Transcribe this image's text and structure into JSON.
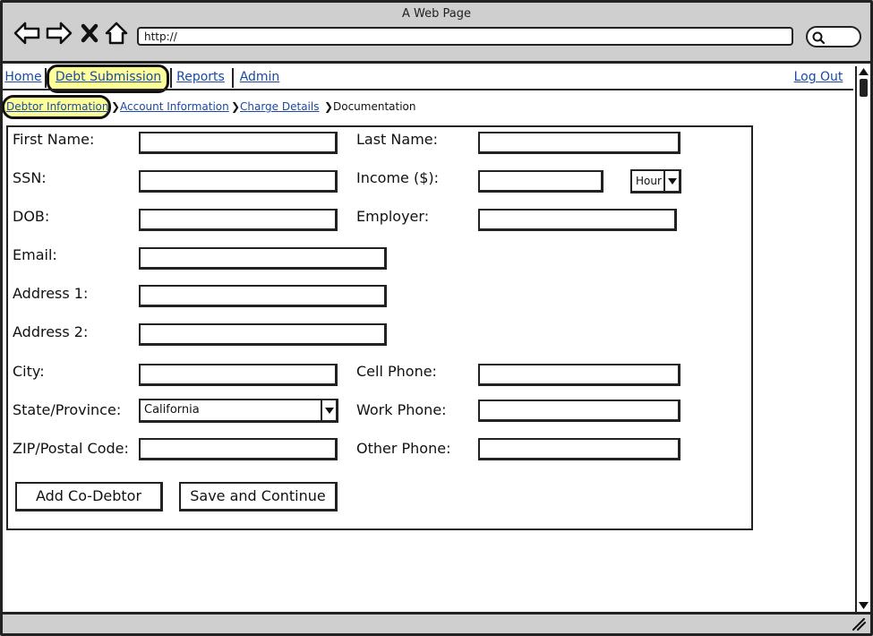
{
  "window": {
    "title": "A Web Page",
    "url": "http://"
  },
  "nav": {
    "tabs": [
      {
        "label": "Home"
      },
      {
        "label": "Debt Submission"
      },
      {
        "label": "Reports"
      },
      {
        "label": "Admin"
      }
    ],
    "logout_label": "Log Out",
    "active_tab": "Debt Submission"
  },
  "breadcrumb": [
    {
      "label": "Debtor Information"
    },
    {
      "label": "Account Information"
    },
    {
      "label": "Charge Details"
    },
    {
      "label": "Documentation"
    }
  ],
  "form": {
    "first_name": {
      "label": "First Name:",
      "value": ""
    },
    "last_name": {
      "label": "Last Name:",
      "value": ""
    },
    "ssn": {
      "label": "SSN:",
      "value": ""
    },
    "income": {
      "label": "Income ($):",
      "value": "",
      "period": "Hour"
    },
    "dob": {
      "label": "DOB:",
      "value": ""
    },
    "employer": {
      "label": "Employer:",
      "value": ""
    },
    "email": {
      "label": "Email:",
      "value": ""
    },
    "address1": {
      "label": "Address 1:",
      "value": ""
    },
    "address2": {
      "label": "Address 2:",
      "value": ""
    },
    "city": {
      "label": "City:",
      "value": ""
    },
    "cell_phone": {
      "label": "Cell Phone:",
      "value": ""
    },
    "state": {
      "label": "State/Province:",
      "value": "California"
    },
    "work_phone": {
      "label": "Work Phone:",
      "value": ""
    },
    "zip": {
      "label": "ZIP/Postal Code:",
      "value": ""
    },
    "other_phone": {
      "label": "Other Phone:",
      "value": ""
    }
  },
  "buttons": {
    "add_co_debtor": "Add Co-Debtor",
    "save_continue": "Save and Continue"
  },
  "colors": {
    "highlight": "#ffff99",
    "link": "#1b4aa0",
    "chrome": "#cfcfcf"
  }
}
